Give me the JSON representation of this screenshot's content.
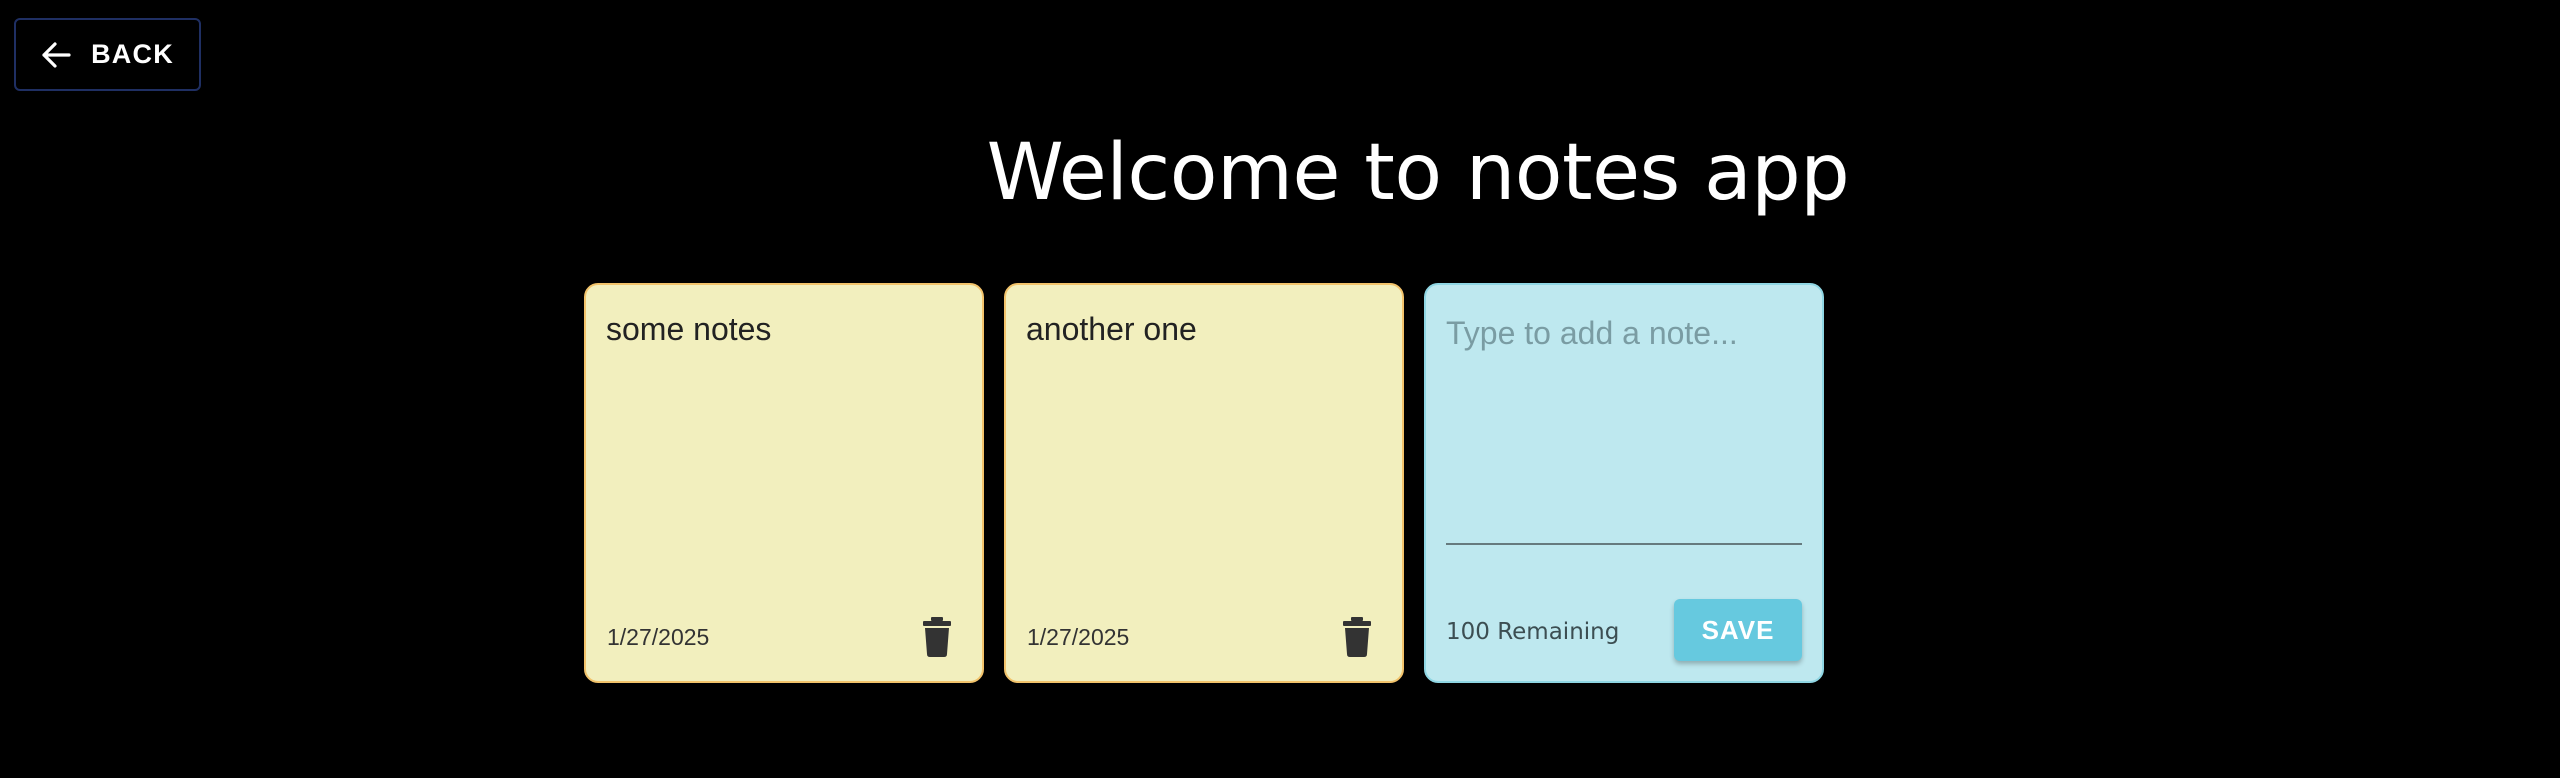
{
  "header": {
    "back_label": "BACK",
    "back_icon": "arrow-left-icon",
    "title": "Welcome to notes app"
  },
  "notes": [
    {
      "text": "some notes",
      "date": "1/27/2025",
      "delete_icon": "trash-icon"
    },
    {
      "text": "another one",
      "date": "1/27/2025",
      "delete_icon": "trash-icon"
    }
  ],
  "new_note": {
    "value": "",
    "placeholder": "Type to add a note...",
    "remaining": "100 Remaining",
    "save_label": "SAVE"
  },
  "colors": {
    "background": "#000000",
    "note_yellow": "#f2efbe",
    "note_yellow_border": "#f2c36b",
    "note_new": "#bee8ef",
    "save_button": "#66c9df",
    "back_border": "#1f2f63"
  }
}
